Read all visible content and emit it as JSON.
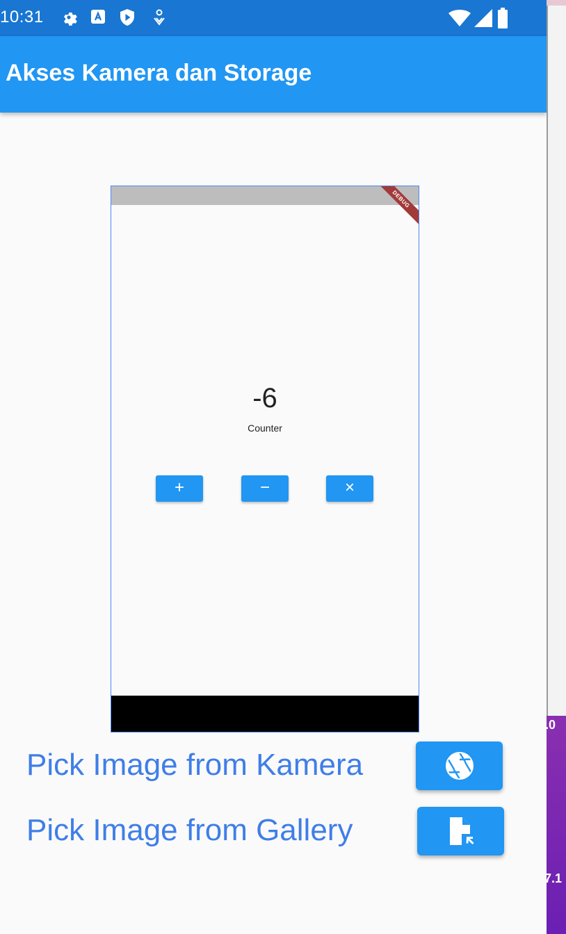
{
  "statusbar": {
    "time": "10:31"
  },
  "appbar": {
    "title": "Akses Kamera dan Storage"
  },
  "preview": {
    "debug_banner": "DEBUG",
    "counter_value": "-6",
    "counter_label": "Counter",
    "buttons": {
      "increment": "+",
      "decrement": "−",
      "reset": "×"
    }
  },
  "actions": {
    "camera_label": "Pick Image from Kamera",
    "gallery_label": "Pick Image from Gallery"
  },
  "background": {
    "text1": ".0",
    "text2": "7.1"
  },
  "colors": {
    "primary": "#2196f3",
    "status_bar": "#1976d2",
    "link_text": "#3f7ee8"
  },
  "icons": [
    "gear-icon",
    "a-icon",
    "shield-play-icon",
    "location-icon",
    "wifi-icon",
    "signal-icon",
    "battery-icon",
    "camera-shutter-icon",
    "file-pick-icon"
  ]
}
